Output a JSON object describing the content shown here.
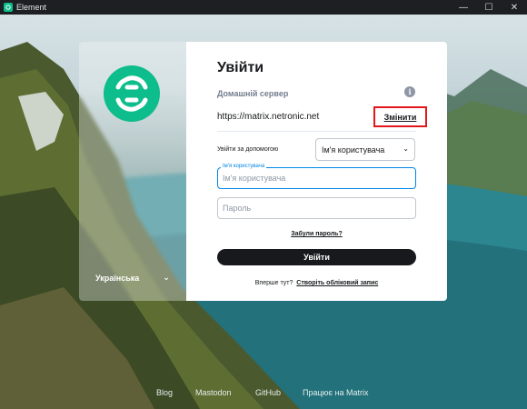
{
  "window": {
    "title": "Element",
    "controls": [
      "—",
      "☐",
      "✕"
    ]
  },
  "left_panel": {
    "language": "Українська"
  },
  "login": {
    "title": "Увійти",
    "homeserver_label": "Домашній сервер",
    "homeserver_url": "https://matrix.netronic.net",
    "change_label": "Змінити",
    "login_with_label": "Увійти за допомогою",
    "login_with_selected": "Ім'я користувача",
    "username_floating_label": "Ім'я користувача",
    "username_placeholder": "Ім'я користувача",
    "password_placeholder": "Пароль",
    "forgot_password": "Забули пароль?",
    "submit_label": "Увійти",
    "new_here": "Вперше тут?",
    "create_account": "Створіть обліковий запис"
  },
  "footer": {
    "links": [
      "Blog",
      "Mastodon",
      "GitHub",
      "Працює на Matrix"
    ]
  },
  "colors": {
    "accent": "#0dbd8b",
    "highlight_border": "#e3161b",
    "focus_border": "#0086e6",
    "button_bg": "#17191c"
  }
}
